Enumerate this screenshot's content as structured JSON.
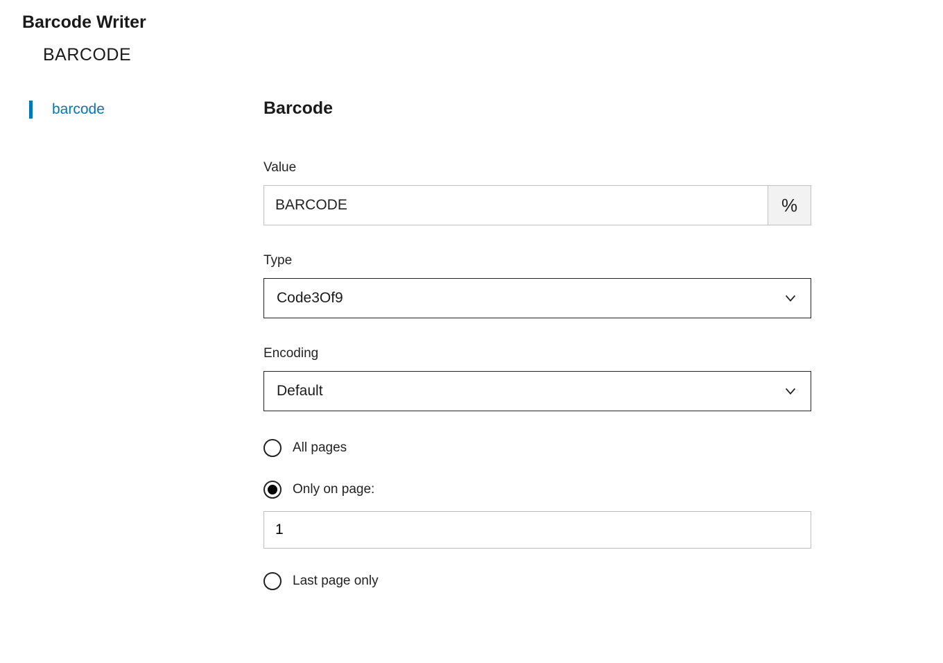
{
  "header": {
    "title": "Barcode Writer",
    "subtitle": "BARCODE"
  },
  "sidebar": {
    "items": [
      {
        "label": "barcode",
        "active": true
      }
    ]
  },
  "main": {
    "heading": "Barcode",
    "fields": {
      "value": {
        "label": "Value",
        "value": "BARCODE",
        "percent_symbol": "%"
      },
      "type": {
        "label": "Type",
        "selected": "Code3Of9"
      },
      "encoding": {
        "label": "Encoding",
        "selected": "Default"
      },
      "pages": {
        "all_label": "All pages",
        "only_label": "Only on page:",
        "only_value": "1",
        "last_label": "Last page only",
        "selected": "only"
      }
    }
  }
}
